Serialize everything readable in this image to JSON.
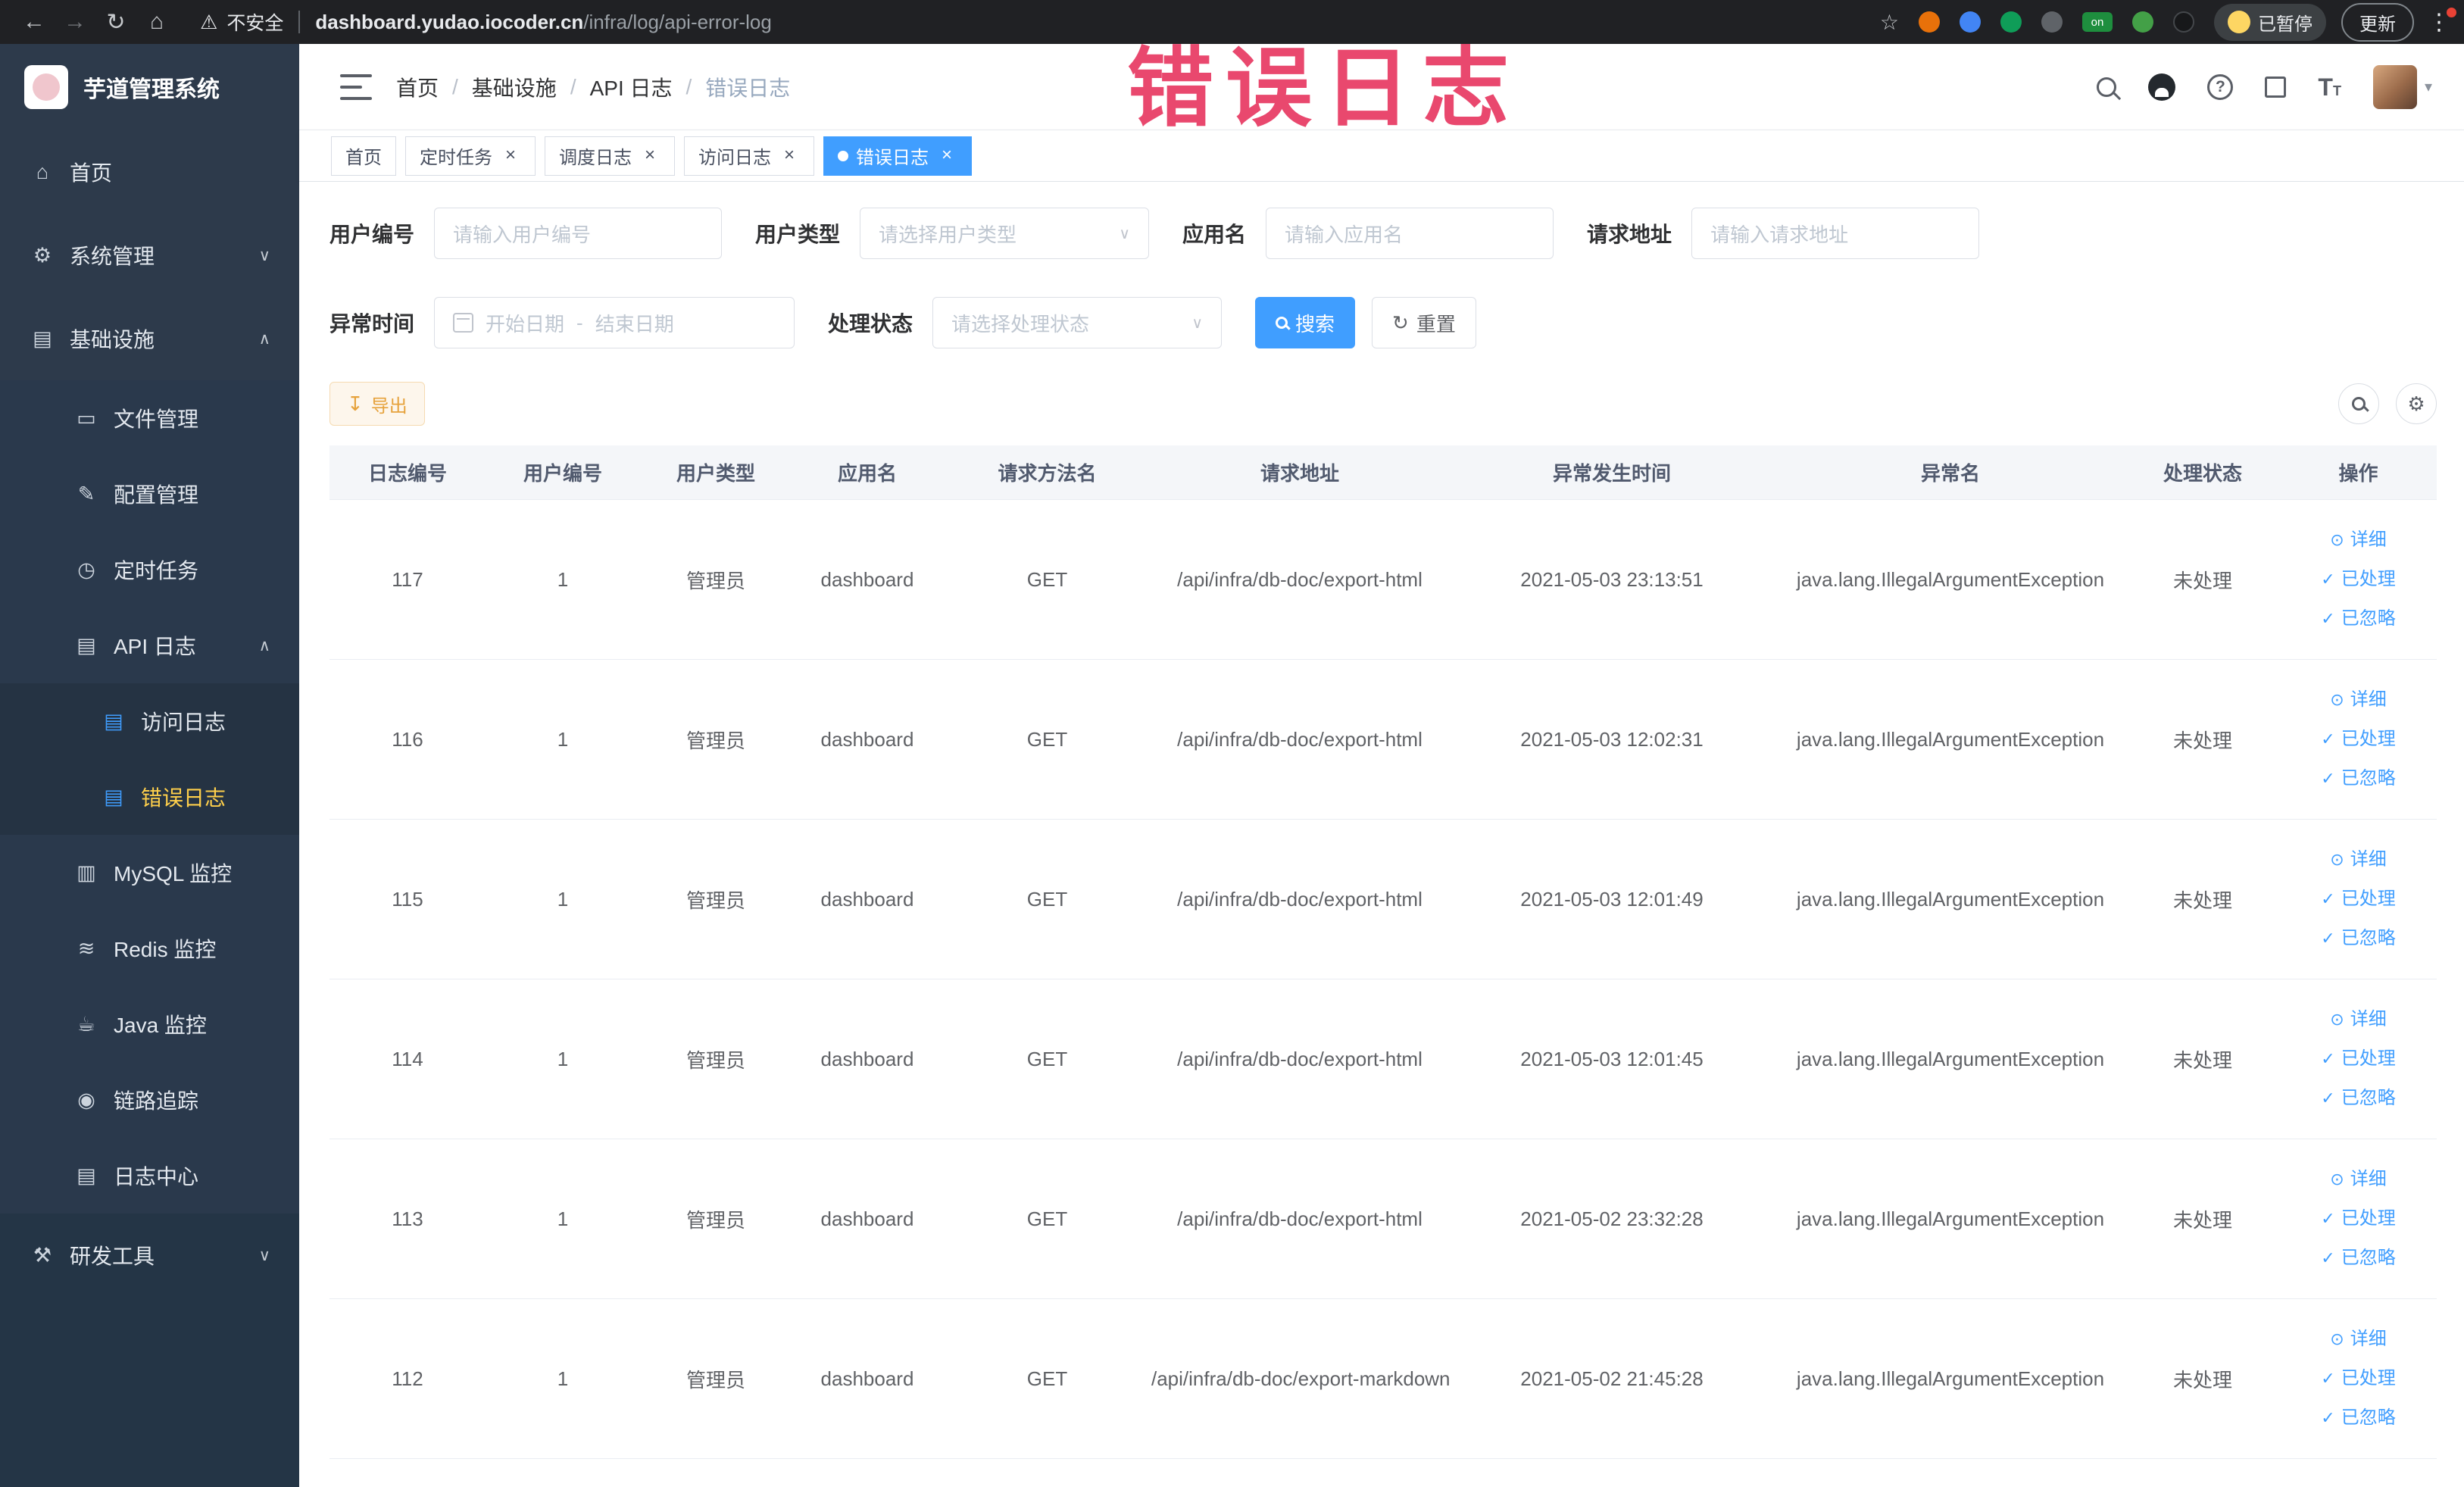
{
  "icons": {
    "back": "←",
    "forward": "→",
    "reload": "↻",
    "home": "⌂",
    "warning": "⚠",
    "star": "☆",
    "dots": "⋮",
    "caret": "▾",
    "close": "×",
    "chevron_up": "∧",
    "chevron_down": "∨",
    "check": "✓",
    "eye": "⊙",
    "download": "↧",
    "refresh": "↻",
    "gear": "⚙"
  },
  "browser": {
    "security_label": "不安全",
    "url_domain": "dashboard.yudao.iocoder.cn",
    "url_path": "/infra/log/api-error-log",
    "extension_on_label": "on",
    "paused_button": "已暂停",
    "update_button": "更新"
  },
  "watermark": "错误日志",
  "sidebar": {
    "logo_title": "芋道管理系统",
    "items": [
      {
        "key": "home",
        "label": "首页",
        "depth": 0,
        "glyph": "⌂",
        "icon": "home-icon"
      },
      {
        "key": "system",
        "label": "系统管理",
        "depth": 0,
        "glyph": "⚙",
        "icon": "gear-icon",
        "arrow": "down"
      },
      {
        "key": "infra",
        "label": "基础设施",
        "depth": 0,
        "glyph": "▤",
        "icon": "infrastructure-icon",
        "arrow": "up"
      },
      {
        "key": "file",
        "label": "文件管理",
        "depth": 1,
        "glyph": "▭",
        "icon": "folder-icon"
      },
      {
        "key": "config",
        "label": "配置管理",
        "depth": 1,
        "glyph": "✎",
        "icon": "edit-icon"
      },
      {
        "key": "job",
        "label": "定时任务",
        "depth": 1,
        "glyph": "◷",
        "icon": "clock-icon"
      },
      {
        "key": "api-log",
        "label": "API 日志",
        "depth": 1,
        "glyph": "▤",
        "icon": "document-icon",
        "arrow": "up"
      },
      {
        "key": "access-log",
        "label": "访问日志",
        "depth": 2,
        "glyph": "▤",
        "icon": "access-log-icon",
        "blue": true
      },
      {
        "key": "error-log",
        "label": "错误日志",
        "depth": 2,
        "glyph": "▤",
        "icon": "error-log-icon",
        "blue": true,
        "active": true
      },
      {
        "key": "mysql",
        "label": "MySQL 监控",
        "depth": 1,
        "glyph": "▥",
        "icon": "database-icon"
      },
      {
        "key": "redis",
        "label": "Redis 监控",
        "depth": 1,
        "glyph": "≋",
        "icon": "redis-icon"
      },
      {
        "key": "java",
        "label": "Java 监控",
        "depth": 1,
        "glyph": "☕",
        "icon": "java-monitor-icon"
      },
      {
        "key": "trace",
        "label": "链路追踪",
        "depth": 1,
        "glyph": "◉",
        "icon": "trace-icon"
      },
      {
        "key": "log-center",
        "label": "日志中心",
        "depth": 1,
        "glyph": "▤",
        "icon": "log-center-icon"
      },
      {
        "key": "dev-tools",
        "label": "研发工具",
        "depth": 0,
        "glyph": "⚒",
        "icon": "tools-icon",
        "arrow": "down",
        "dim": true
      }
    ]
  },
  "navbar": {
    "breadcrumb": [
      "首页",
      "基础设施",
      "API 日志",
      "错误日志"
    ]
  },
  "tabs": [
    {
      "key": "home",
      "label": "首页",
      "closable": false,
      "active": false
    },
    {
      "key": "job",
      "label": "定时任务",
      "closable": true,
      "active": false
    },
    {
      "key": "job-log",
      "label": "调度日志",
      "closable": true,
      "active": false
    },
    {
      "key": "access-log",
      "label": "访问日志",
      "closable": true,
      "active": false
    },
    {
      "key": "error-log",
      "label": "错误日志",
      "closable": true,
      "active": true
    }
  ],
  "filters": {
    "user_id": {
      "label": "用户编号",
      "placeholder": "请输入用户编号"
    },
    "user_type": {
      "label": "用户类型",
      "placeholder": "请选择用户类型"
    },
    "app_name": {
      "label": "应用名",
      "placeholder": "请输入应用名"
    },
    "request_url": {
      "label": "请求地址",
      "placeholder": "请输入请求地址"
    },
    "exception_time": {
      "label": "异常时间",
      "start_placeholder": "开始日期",
      "separator": "-",
      "end_placeholder": "结束日期"
    },
    "process_status": {
      "label": "处理状态",
      "placeholder": "请选择处理状态"
    },
    "search_button": "搜索",
    "reset_button": "重置"
  },
  "toolbar": {
    "export_button": "导出"
  },
  "table": {
    "columns": [
      "日志编号",
      "用户编号",
      "用户类型",
      "应用名",
      "请求方法名",
      "请求地址",
      "异常发生时间",
      "异常名",
      "处理状态",
      "操作"
    ],
    "action_labels": {
      "detail": "详细",
      "processed": "已处理",
      "ignored": "已忽略"
    },
    "rows": [
      {
        "id": "117",
        "user_id": "1",
        "user_type": "管理员",
        "app": "dashboard",
        "method": "GET",
        "url": "/api/infra/db-doc/export-html",
        "time": "2021-05-03 23:13:51",
        "exception": "java.lang.IllegalArgumentException",
        "status": "未处理"
      },
      {
        "id": "116",
        "user_id": "1",
        "user_type": "管理员",
        "app": "dashboard",
        "method": "GET",
        "url": "/api/infra/db-doc/export-html",
        "time": "2021-05-03 12:02:31",
        "exception": "java.lang.IllegalArgumentException",
        "status": "未处理"
      },
      {
        "id": "115",
        "user_id": "1",
        "user_type": "管理员",
        "app": "dashboard",
        "method": "GET",
        "url": "/api/infra/db-doc/export-html",
        "time": "2021-05-03 12:01:49",
        "exception": "java.lang.IllegalArgumentException",
        "status": "未处理"
      },
      {
        "id": "114",
        "user_id": "1",
        "user_type": "管理员",
        "app": "dashboard",
        "method": "GET",
        "url": "/api/infra/db-doc/export-html",
        "time": "2021-05-03 12:01:45",
        "exception": "java.lang.IllegalArgumentException",
        "status": "未处理"
      },
      {
        "id": "113",
        "user_id": "1",
        "user_type": "管理员",
        "app": "dashboard",
        "method": "GET",
        "url": "/api/infra/db-doc/export-html",
        "time": "2021-05-02 23:32:28",
        "exception": "java.lang.IllegalArgumentException",
        "status": "未处理"
      },
      {
        "id": "112",
        "user_id": "1",
        "user_type": "管理员",
        "app": "dashboard",
        "method": "GET",
        "url": "/api/infra/db-doc/export-markdown",
        "time": "2021-05-02 21:45:28",
        "exception": "java.lang.IllegalArgumentException",
        "status": "未处理"
      }
    ]
  }
}
